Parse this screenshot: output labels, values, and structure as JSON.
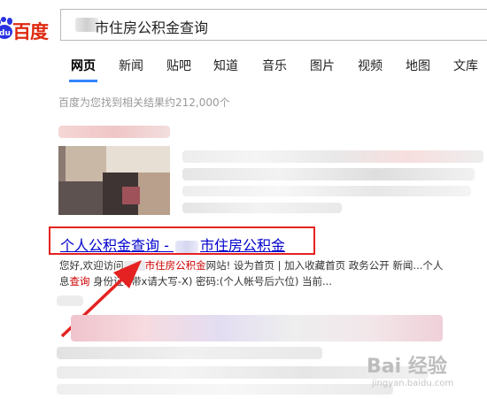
{
  "header": {
    "logo_text": "百度",
    "search_query": "市住房公积金查询"
  },
  "tabs": [
    "网页",
    "新闻",
    "贴吧",
    "知道",
    "音乐",
    "图片",
    "视频",
    "地图",
    "文库"
  ],
  "result_count": "百度为您找到相关结果约212,000个",
  "result": {
    "title_prefix": "个人公积金查询 - ",
    "title_suffix": "市住房公积金",
    "snippet_line1": {
      "a": "您好,欢迎访问",
      "b_em": "市住房公积金",
      "c": "网站! 设为首页 | 加入收藏首页 政务公开 新闻...个人"
    },
    "snippet_line2": {
      "a": "息",
      "b_em": "查询",
      "c": " 身份证:(带x请大写-X) 密码:(个人帐号后六位) 当前..."
    }
  },
  "watermark": {
    "main": "Bai 经验",
    "sub": "jingyan.baidu.com"
  },
  "colors": {
    "brand_red": "#de2910",
    "brand_blue": "#2932e1",
    "link": "#0000cc",
    "highlight_box": "#e52222",
    "active_tab_underline": "#3385ff"
  }
}
